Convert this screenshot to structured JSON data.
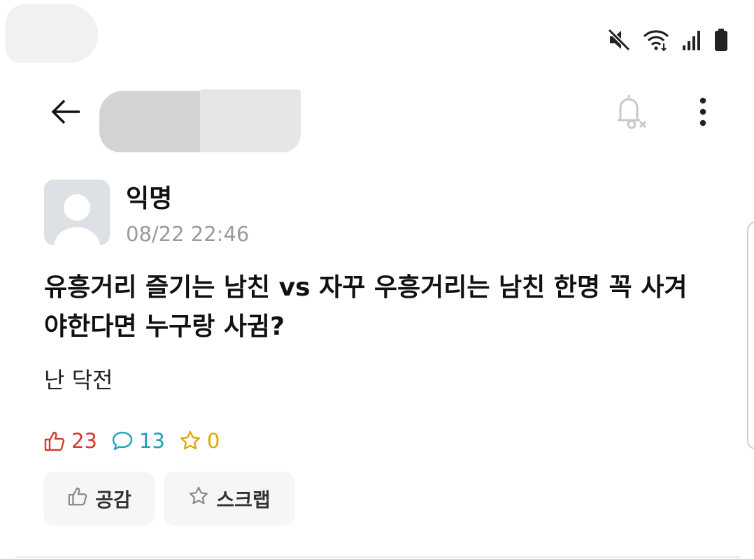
{
  "status_bar": {
    "icons": [
      "mute-icon",
      "wifi-icon",
      "signal-icon",
      "battery-icon"
    ]
  },
  "app_bar": {
    "back_icon": "arrow-left-icon",
    "notify_icon": "bell-off-icon",
    "more_icon": "more-vertical-icon"
  },
  "post": {
    "author": "익명",
    "timestamp": "08/22 22:46",
    "title": "유흥거리 즐기는 남친 vs 자꾸 우흥거리는 남친 한명 꼭 사겨야한다면 누구랑 사귐?",
    "body": "난 닥전",
    "stats": {
      "likes": "23",
      "comments": "13",
      "scraps": "0"
    }
  },
  "actions": {
    "like_label": "공감",
    "scrap_label": "스크랩"
  },
  "colors": {
    "like": "#d23a2a",
    "comment": "#1ea0c0",
    "scrap": "#e0a800"
  }
}
